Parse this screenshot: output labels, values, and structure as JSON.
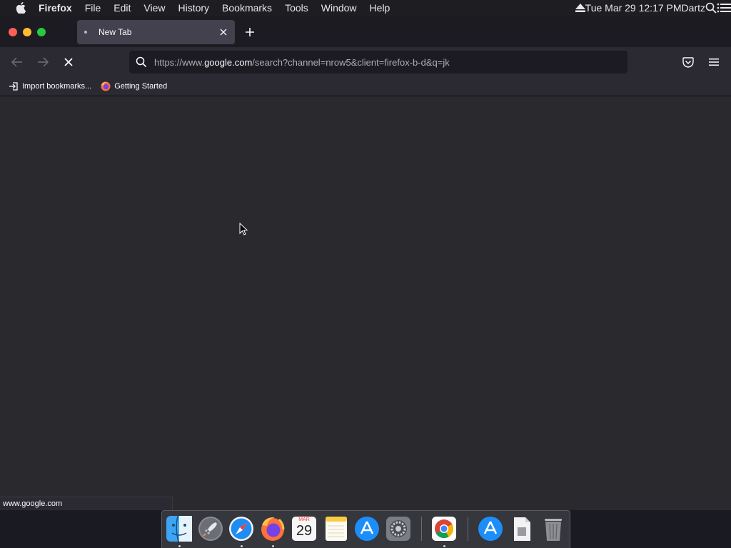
{
  "menubar": {
    "app_name": "Firefox",
    "items": [
      "File",
      "Edit",
      "View",
      "History",
      "Bookmarks",
      "Tools",
      "Window",
      "Help"
    ],
    "clock": "Tue Mar 29  12:17 PM",
    "user": "Dartz"
  },
  "tab": {
    "title": "New Tab"
  },
  "urlbar": {
    "prefix": "https://www.",
    "domain": "google.com",
    "path": "/search?channel=nrow5&client=firefox-b-d&q=jk"
  },
  "bookmarks": {
    "import_label": "Import bookmarks...",
    "getting_started_label": "Getting Started"
  },
  "status": {
    "text": "www.google.com"
  },
  "dock": {
    "calendar_month": "MAR",
    "calendar_day": "29"
  },
  "colors": {
    "accent_close": "#fe5f57",
    "accent_min": "#febc2e",
    "accent_max": "#28c840"
  }
}
